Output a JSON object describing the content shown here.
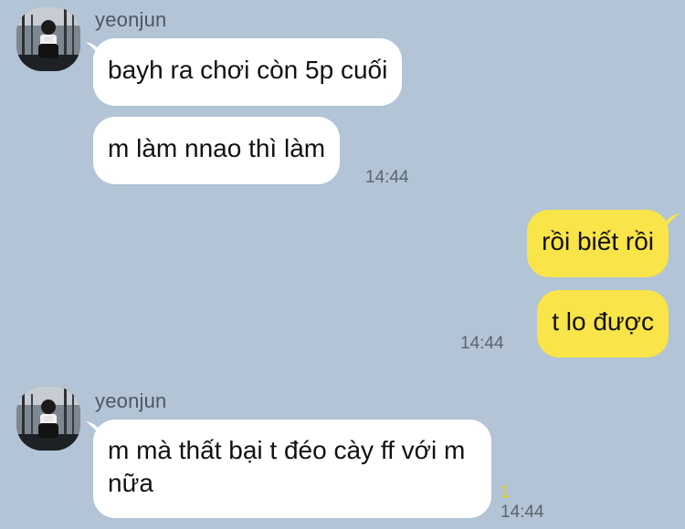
{
  "chat": {
    "contact_name": "yeonjun",
    "avatar_icon": "profile-photo",
    "colors": {
      "background": "#b2c4d5",
      "incoming_bubble": "#ffffff",
      "outgoing_bubble": "#f9e449",
      "unread": "#e8d000"
    },
    "groups": [
      {
        "sender": "yeonjun",
        "messages": [
          "bayh ra chơi còn 5p cuối",
          "m làm nnao thì làm"
        ],
        "time": "14:44"
      },
      {
        "sender": "me",
        "messages": [
          "rồi biết rồi",
          "t lo được"
        ],
        "time": "14:44"
      },
      {
        "sender": "yeonjun",
        "messages": [
          "m mà thất bại t đéo cày ff với m nữa"
        ],
        "time": "14:44",
        "unread_count": "1"
      }
    ]
  }
}
